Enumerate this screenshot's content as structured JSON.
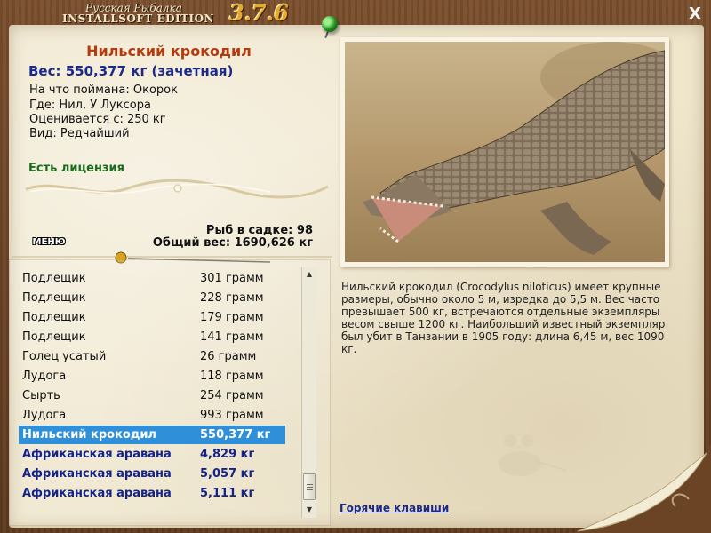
{
  "window": {
    "brand_top": "Русская Рыбалка",
    "brand_bottom": "INSTALLSOFT EDITION",
    "version": "3.7.6",
    "close_label": "X"
  },
  "catch": {
    "name": "Нильский крокодил",
    "weight_line": "Вес: 550,377 кг (зачетная)",
    "bait_line": "На что поймана: Окорок",
    "place_line": "Где: Нил, У Луксора",
    "value_line": "Оценивается с: 250 кг",
    "kind_line": "Вид: Редчайший",
    "license": "Есть лицензия"
  },
  "net": {
    "count_line": "Рыб в садке: 98",
    "total_line": "Общий вес: 1690,626 кг"
  },
  "menu": {
    "label": "МЕНЮ"
  },
  "fish_list": [
    {
      "name": "Подлещик",
      "weight": "301 грамм",
      "state": "normal"
    },
    {
      "name": "Подлещик",
      "weight": "228 грамм",
      "state": "normal"
    },
    {
      "name": "Подлещик",
      "weight": "179 грамм",
      "state": "normal"
    },
    {
      "name": "Подлещик",
      "weight": "141 грамм",
      "state": "normal"
    },
    {
      "name": "Голец усатый",
      "weight": "26 грамм",
      "state": "normal"
    },
    {
      "name": "Лудога",
      "weight": "118 грамм",
      "state": "normal"
    },
    {
      "name": "Сырть",
      "weight": "254 грамм",
      "state": "normal"
    },
    {
      "name": "Лудога",
      "weight": "993 грамм",
      "state": "normal"
    },
    {
      "name": "Нильский крокодил",
      "weight": "550,377 кг",
      "state": "selected"
    },
    {
      "name": "Африканская аравана",
      "weight": "4,829 кг",
      "state": "highlight"
    },
    {
      "name": "Африканская аравана",
      "weight": "5,057 кг",
      "state": "highlight"
    },
    {
      "name": "Африканская аравана",
      "weight": "5,111 кг",
      "state": "highlight"
    }
  ],
  "description": "Нильский крокодил (Crocodylus niloticus) имеет крупные размеры, обычно около 5 м, изредка до 5,5 м. Вес часто превышает 500 кг, встречаются отдельные экземпляры весом свыше 1200 кг. Наибольший известный экземпляр был убит в Танзании в 1905 году: длина 6,45 м, вес 1090 кг.",
  "hotkeys_label": "Горячие клавиши",
  "colors": {
    "accent_title": "#b33c0e",
    "weight_blue": "#1b2a8a",
    "license_green": "#1c6a1c",
    "selection": "#2f8fd8",
    "version_gold": "#e7a92a"
  },
  "icons": [
    "close-icon",
    "pin-icon",
    "scroll-up-icon",
    "scroll-down-icon",
    "fishing-bobber-icon",
    "fisherman-boat-icon"
  ]
}
